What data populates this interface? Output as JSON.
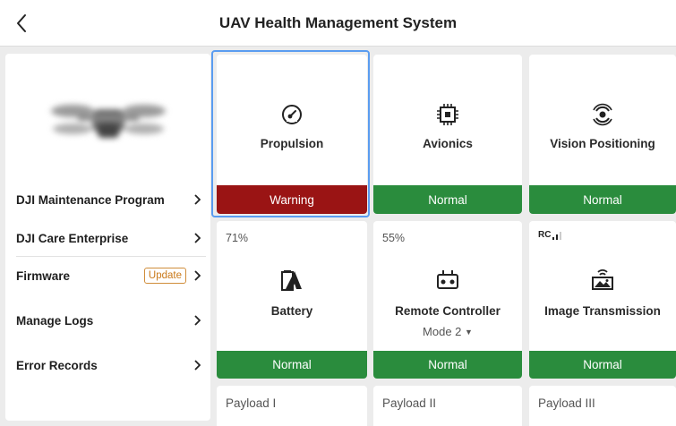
{
  "header": {
    "title": "UAV Health Management System",
    "back_icon": "chevron-left-icon"
  },
  "sidebar": {
    "items": [
      {
        "label": "DJI Maintenance Program"
      },
      {
        "label": "DJI Care Enterprise"
      },
      {
        "label": "Firmware",
        "badge": "Update"
      },
      {
        "label": "Manage Logs"
      },
      {
        "label": "Error Records"
      }
    ]
  },
  "modules": [
    {
      "name": "Propulsion",
      "status": "Warning",
      "icon": "gauge-icon"
    },
    {
      "name": "Avionics",
      "status": "Normal",
      "icon": "chip-icon"
    },
    {
      "name": "Vision Positioning",
      "status": "Normal",
      "icon": "camera-lens-icon"
    },
    {
      "name": "Battery",
      "status": "Normal",
      "icon": "battery-icon",
      "level": "71%"
    },
    {
      "name": "Remote Controller",
      "status": "Normal",
      "icon": "remote-controller-icon",
      "level": "55%",
      "mode": "Mode 2"
    },
    {
      "name": "Image Transmission",
      "status": "Normal",
      "icon": "image-transmission-icon",
      "signal_label": "RC",
      "signal_bars": 2
    },
    {
      "name": "Payload I"
    },
    {
      "name": "Payload II"
    },
    {
      "name": "Payload III"
    }
  ],
  "colors": {
    "normal": "#2a8c3d",
    "warning": "#9a1414",
    "selected": "#5a9cf0",
    "accent": "#c9791a"
  }
}
